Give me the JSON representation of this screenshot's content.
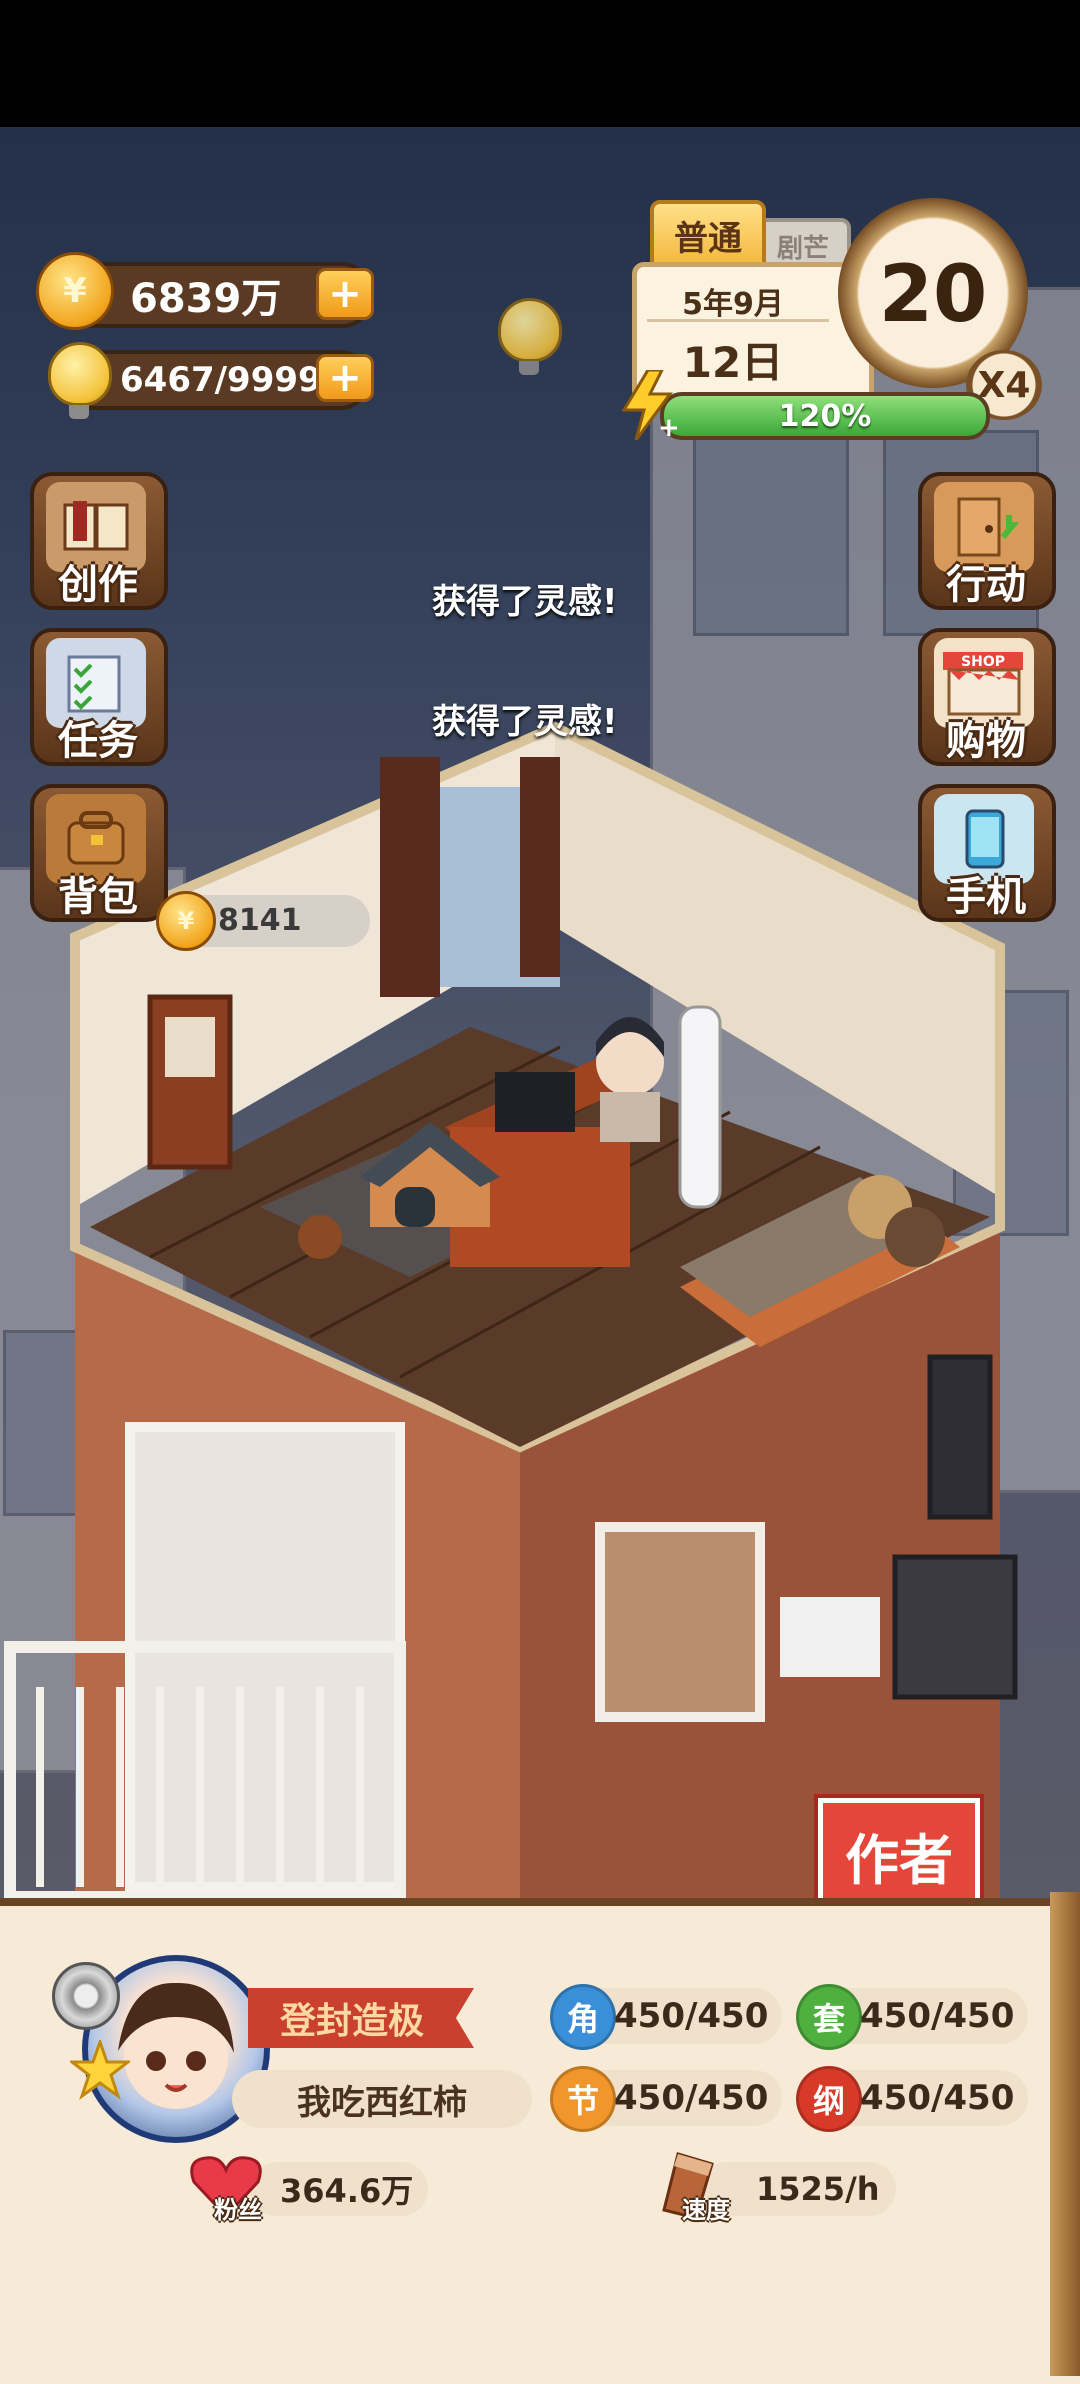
{
  "hud": {
    "coins": "6839万",
    "inspiration": "6467/9999",
    "plus": "+",
    "mode": "普通",
    "mode_other": "剧芒",
    "year_month": "5年9月",
    "day": "12日",
    "day_counter": "20",
    "speed": "X4",
    "energy_percent": "120%",
    "energy_fill": 1.0
  },
  "left_menu": [
    {
      "label": "创作",
      "icon": "book-icon"
    },
    {
      "label": "任务",
      "icon": "checklist-icon"
    },
    {
      "label": "背包",
      "icon": "bag-icon"
    }
  ],
  "right_menu": [
    {
      "label": "行动",
      "icon": "door-icon"
    },
    {
      "label": "购物",
      "icon": "shop-icon"
    },
    {
      "label": "手机",
      "icon": "phone-icon"
    }
  ],
  "shop_sign": "SHOP",
  "floating_messages": [
    "获得了灵感!",
    "获得了灵感!"
  ],
  "room_coin_value": "8141",
  "author_button": "作者",
  "profile": {
    "rank": "登封造极",
    "name": "我吃西红柿",
    "fans_label": "粉丝",
    "fans": "364.6万",
    "speed_label": "速度",
    "speed": "1525/h",
    "stats": [
      {
        "badge": "角",
        "value": "450/450",
        "color": "#3a8fd8"
      },
      {
        "badge": "套",
        "value": "450/450",
        "color": "#4fb040"
      },
      {
        "badge": "节",
        "value": "450/450",
        "color": "#f0962a"
      },
      {
        "badge": "纲",
        "value": "450/450",
        "color": "#d83a2a"
      }
    ]
  }
}
